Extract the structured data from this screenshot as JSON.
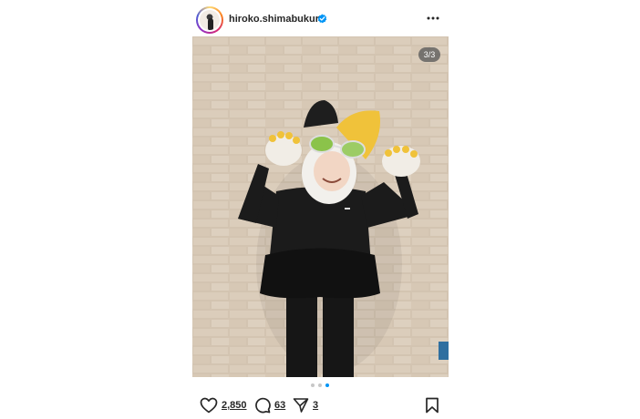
{
  "post": {
    "username": "hiroko.shimabukuro",
    "verified": true,
    "carousel_counter": "3/3",
    "carousel_total": 3,
    "carousel_active_index": 3
  },
  "actions": {
    "likes": "2,850",
    "comments": "63",
    "shares": "3"
  },
  "icons": {
    "avatar": "profile-avatar",
    "verified": "verified-badge-icon",
    "more": "more-options-icon",
    "like": "heart-icon",
    "comment": "comment-icon",
    "share": "share-icon",
    "save": "bookmark-icon"
  },
  "colors": {
    "verified_blue": "#0095f6",
    "text": "#262626",
    "dot_inactive": "#c7c7c7"
  }
}
